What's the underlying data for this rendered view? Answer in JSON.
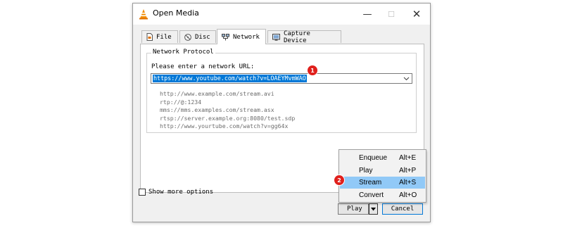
{
  "window": {
    "title": "Open Media",
    "minimize": "—",
    "maximize": "☐",
    "close": "✕"
  },
  "tabs": [
    {
      "label": "File"
    },
    {
      "label": "Disc"
    },
    {
      "label": "Network",
      "active": true
    },
    {
      "label": "Capture Device"
    }
  ],
  "network": {
    "group_title": "Network Protocol",
    "url_label": "Please enter a network URL:",
    "url_value": "https://www.youtube.com/watch?v=LOAEYMvmWAO",
    "examples": [
      "http://www.example.com/stream.avi",
      "rtp://@:1234",
      "mms://mms.examples.com/stream.asx",
      "rtsp://server.example.org:8080/test.sdp",
      "http://www.yourtube.com/watch?v=gg64x"
    ]
  },
  "show_more_options": {
    "label": "Show more options",
    "checked": false
  },
  "buttons": {
    "play": "Play",
    "cancel": "Cancel"
  },
  "menu": {
    "items": [
      {
        "label": "Enqueue",
        "shortcut": "Alt+E"
      },
      {
        "label": "Play",
        "shortcut": "Alt+P"
      },
      {
        "label": "Stream",
        "shortcut": "Alt+S",
        "highlighted": true
      },
      {
        "label": "Convert",
        "shortcut": "Alt+O"
      }
    ]
  },
  "badges": {
    "first": "1",
    "second": "2"
  },
  "colors": {
    "selection": "#0078d7",
    "menu_highlight": "#91c9f7",
    "badge": "#e0201c"
  }
}
